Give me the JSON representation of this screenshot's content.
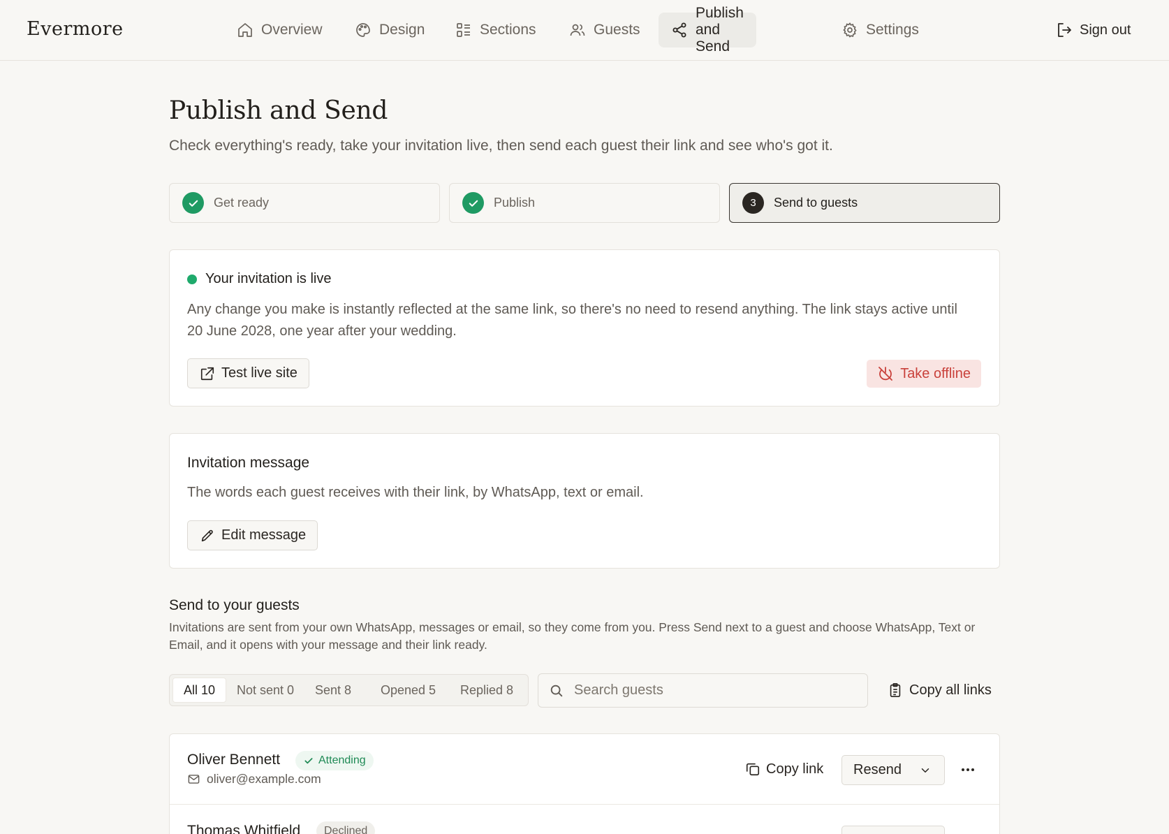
{
  "app": {
    "brand": "Evermore"
  },
  "nav": {
    "items": [
      {
        "label": "Overview",
        "icon": "home-icon"
      },
      {
        "label": "Design",
        "icon": "palette-icon"
      },
      {
        "label": "Sections",
        "icon": "sections-icon"
      },
      {
        "label": "Guests",
        "icon": "users-icon"
      },
      {
        "label": "Publish and Send",
        "icon": "share-icon",
        "active": true
      },
      {
        "label": "Settings",
        "icon": "gear-icon"
      }
    ],
    "sign_out": "Sign out"
  },
  "page": {
    "title": "Publish and Send",
    "subtitle": "Check everything's ready, take your invitation live, then send each guest their link and see who's got it."
  },
  "steps": [
    {
      "label": "Get ready",
      "state": "done"
    },
    {
      "label": "Publish",
      "state": "done"
    },
    {
      "number": "3",
      "label": "Send to guests",
      "state": "current"
    }
  ],
  "live": {
    "title": "Your invitation is live",
    "body": "Any change you make is instantly reflected at the same link, so there's no need to resend anything. The link stays active until 20 June 2028, one year after your wedding.",
    "test_label": "Test live site",
    "offline_label": "Take offline",
    "status_color": "#1faa6c"
  },
  "message": {
    "title": "Invitation message",
    "body": "The words each guest receives with their link, by WhatsApp, text or email.",
    "edit_label": "Edit message"
  },
  "send": {
    "title": "Send to your guests",
    "description": "Invitations are sent from your own WhatsApp, messages or email, so they come from you. Press Send next to a guest and choose WhatsApp, Text or Email, and it opens with your message and their link ready.",
    "filters": [
      {
        "label": "All 10",
        "active": true
      },
      {
        "label": "Not sent 0"
      },
      {
        "label": "Sent 8"
      },
      {
        "label": "Opened 5"
      },
      {
        "label": "Replied 8"
      }
    ],
    "search_placeholder": "Search guests",
    "copy_all_label": "Copy all links"
  },
  "guests": [
    {
      "name": "Oliver Bennett",
      "status": "Attending",
      "email": "oliver@example.com",
      "copy_label": "Copy link",
      "action_label": "Resend"
    },
    {
      "name": "Thomas Whitfield",
      "status": "Declined"
    }
  ],
  "colors": {
    "accent_green": "#1f9a63",
    "danger": "#c9413b",
    "danger_bg": "#f9e4e2",
    "background": "#f8f7f4"
  }
}
